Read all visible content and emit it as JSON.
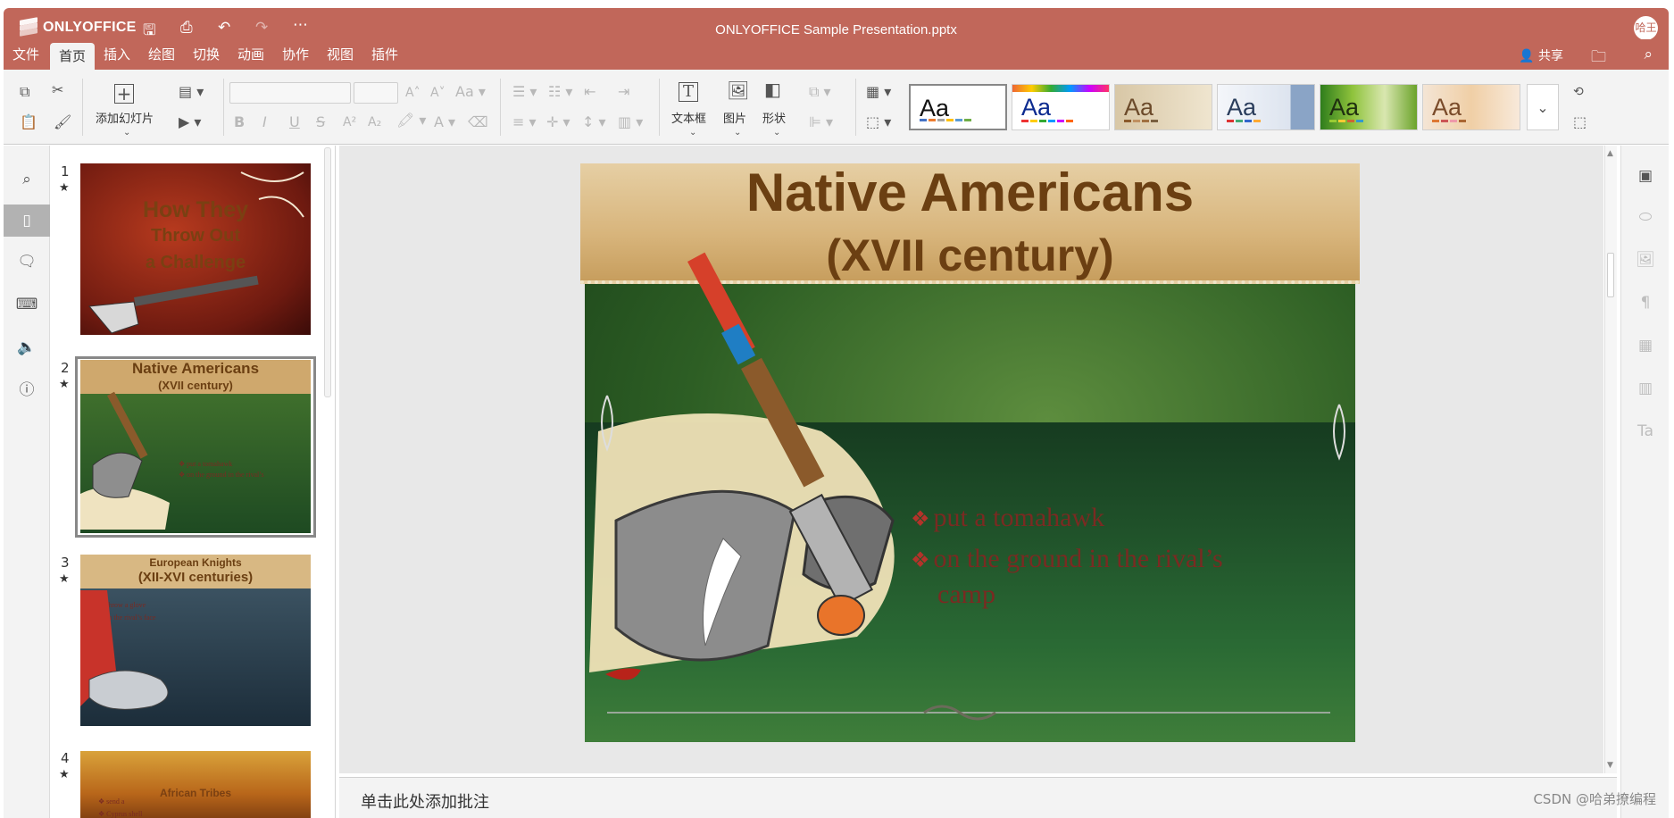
{
  "app": {
    "name": "ONLYOFFICE",
    "document_title": "ONLYOFFICE Sample Presentation.pptx",
    "user_initials": "哈王"
  },
  "menu": {
    "tabs": [
      "文件",
      "首页",
      "插入",
      "绘图",
      "切换",
      "动画",
      "协作",
      "视图",
      "插件"
    ],
    "active_tab": "首页",
    "share_label": "共享"
  },
  "toolbar": {
    "add_slide_label": "添加幻灯片",
    "textbox_label": "文本框",
    "image_label": "图片",
    "shape_label": "形状",
    "theme_sample_text": "Aa"
  },
  "slides": [
    {
      "number": "1",
      "title_lines": [
        "How They",
        "Throw Out",
        "a Challenge"
      ]
    },
    {
      "number": "2",
      "title": "Native Americans",
      "subtitle": "(XVII century)",
      "bullets": [
        "put a tomahawk",
        "on the ground in the rival’s"
      ]
    },
    {
      "number": "3",
      "title": "European Knights",
      "subtitle": "(XII-XVI centuries)",
      "bullets": [
        "throw a glove",
        "in the rival’s face"
      ]
    },
    {
      "number": "4",
      "title": "African Tribes",
      "bullets": [
        "send a",
        "Cyprus shell"
      ]
    }
  ],
  "current_slide": {
    "title": "Native Americans",
    "subtitle": "(XVII century)",
    "bullets": [
      "put a tomahawk",
      "on the ground in the rival’s",
      "camp"
    ]
  },
  "notes": {
    "placeholder": "单击此处添加批注"
  },
  "watermark": "CSDN @哈弟撩编程",
  "colors": {
    "brand": "#c1675a",
    "toolbar_bg": "#f3f3f3",
    "work_bg": "#e8e8e8",
    "title_brown": "#6b3f12"
  },
  "icons": {
    "left_rail": [
      "search-icon",
      "slides-icon",
      "comment-icon",
      "chat-icon",
      "speaker-icon",
      "info-icon"
    ],
    "right_rail": [
      "slide-settings-icon",
      "shape-settings-icon",
      "image-settings-icon",
      "paragraph-icon",
      "table-icon",
      "chart-icon",
      "text-art-icon"
    ]
  }
}
